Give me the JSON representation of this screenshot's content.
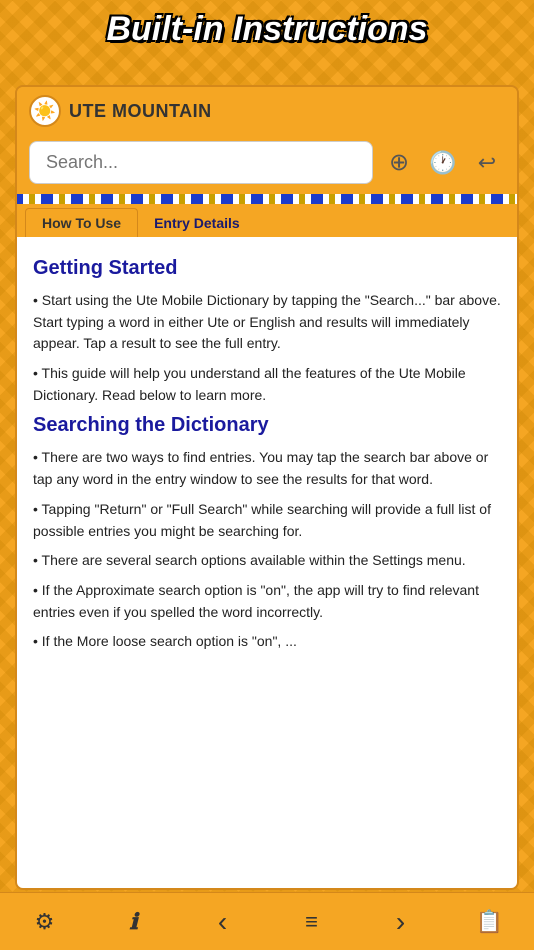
{
  "page": {
    "top_title": "Built-in Instructions"
  },
  "header": {
    "logo_emoji": "🌞",
    "app_name": "UTE MOUNTAIN"
  },
  "search": {
    "placeholder": "Search...",
    "zoom_icon": "⊕",
    "history_icon": "🕐",
    "back_icon": "↩"
  },
  "tabs": [
    {
      "label": "How To Use",
      "active": true
    },
    {
      "label": "Entry Details",
      "active": false
    }
  ],
  "content": {
    "sections": [
      {
        "title": "Getting Started",
        "paragraphs": [
          "• Start using the Ute Mobile Dictionary by tapping the \"Search...\" bar above.  Start typing a word in either Ute or English and results will immediately appear.  Tap a result to see the full entry.",
          "• This guide will help you understand all the features of the Ute Mobile Dictionary.  Read below to learn more."
        ]
      },
      {
        "title": "Searching the Dictionary",
        "paragraphs": [
          "• There are two ways to find entries.  You may tap the search bar above or tap any word in the entry window to see the results for that word.",
          "• Tapping \"Return\" or \"Full Search\" while searching will provide a full list of possible entries you might be searching for.",
          "• There are several search options available within the Settings menu.",
          "• If the Approximate search option is \"on\", the app will try to find relevant entries even if you spelled the word incorrectly.",
          "• If the More loose search option is \"on\", ..."
        ]
      }
    ]
  },
  "toolbar": {
    "settings_icon": "⚙",
    "info_icon": "ℹ",
    "back_icon": "‹",
    "menu_icon": "≡",
    "forward_icon": "›",
    "clipboard_icon": "📋"
  }
}
